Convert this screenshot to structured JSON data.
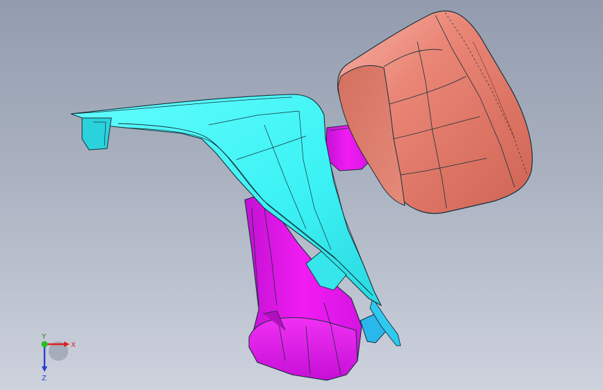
{
  "viewport": {
    "part_colors": {
      "cowl_panel": "#3ff5f5",
      "cowl_shadow": "#23c9cf",
      "grip_body": "#ee16ee",
      "grip_shadow": "#b00fbf",
      "housing": "#e98272",
      "housing_shadow": "#c9604f",
      "clip": "#2ab7ec",
      "edge_line": "#14303a"
    }
  },
  "triad": {
    "x_label": "X",
    "y_label": "Y",
    "z_label": "Z",
    "x_color": "#e02020",
    "y_color": "#22c022",
    "z_color": "#2a3fd0"
  }
}
